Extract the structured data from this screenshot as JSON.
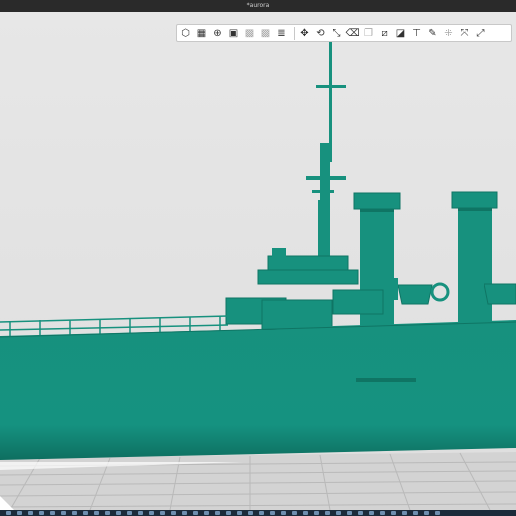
{
  "window": {
    "title": "*aurora"
  },
  "toolbar": {
    "groups": [
      [
        {
          "icon": "view-cube-icon",
          "glyph": "⬡"
        },
        {
          "icon": "grid-view-icon",
          "glyph": "▦"
        },
        {
          "icon": "section-view-icon",
          "glyph": "⊕"
        },
        {
          "icon": "render-view-icon",
          "glyph": "▣"
        },
        {
          "icon": "wireframe-icon",
          "glyph": "▩",
          "dim": true
        },
        {
          "icon": "mesh-view-icon",
          "glyph": "▩",
          "dim": true
        },
        {
          "icon": "layers-icon",
          "glyph": "≣"
        }
      ],
      [
        {
          "icon": "move-icon",
          "glyph": "✥"
        },
        {
          "icon": "rotate-icon",
          "glyph": "⟲"
        },
        {
          "icon": "scale-icon",
          "glyph": "⤡"
        },
        {
          "icon": "eraser-icon",
          "glyph": "⌫"
        },
        {
          "icon": "copy-icon",
          "glyph": "❐",
          "dim": true
        },
        {
          "icon": "split-icon",
          "glyph": "⧄"
        },
        {
          "icon": "cut-icon",
          "glyph": "◪"
        },
        {
          "icon": "support-icon",
          "glyph": "⊤"
        },
        {
          "icon": "paint-icon",
          "glyph": "✎"
        },
        {
          "icon": "repair-icon",
          "glyph": "⁜",
          "dim": true
        },
        {
          "icon": "arrange-icon",
          "glyph": "⤧"
        },
        {
          "icon": "fullscreen-icon",
          "glyph": "⤢"
        }
      ]
    ]
  },
  "colors": {
    "model": "#17917e",
    "model_dark": "#0f7564",
    "bed": "#d3d3d3",
    "bed_grid": "#b9b9b9",
    "background": "#e4e4e4"
  },
  "taskbar": {
    "count": 40
  }
}
